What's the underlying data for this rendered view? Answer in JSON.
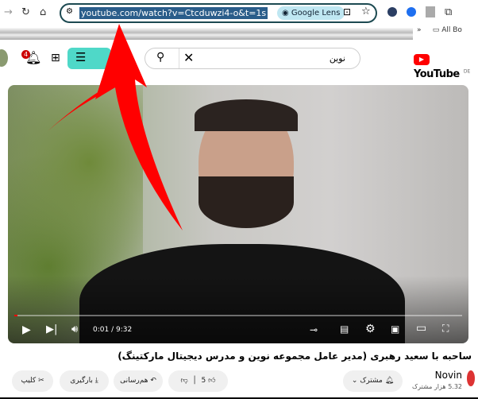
{
  "browser": {
    "url": "youtube.com/watch?v=Ctcduwzi4-o&t=1s",
    "lens_label": "Google Lens",
    "bookmarks_label": "All Bo"
  },
  "youtube": {
    "logo": "YouTube",
    "region": "DE",
    "notification_count": "4",
    "search_value": "نوین"
  },
  "player": {
    "time": "0:01 / 9:32",
    "progress": 0.002
  },
  "video": {
    "title": "ساحبه با سعید رهبری (مدیر عامل مجموعه نوین و مدرس دیجیتال مارکتینگ)",
    "channel": "Novin",
    "subscribers": "5.32 هزار مشترک",
    "subscribe_label": "مشترک",
    "likes": "5",
    "share_label": "هم‌رسانی",
    "download_label": "بارگیری",
    "clip_label": "کلیپ"
  },
  "colors": {
    "accent_red": "#ff0000",
    "url_border": "#1d4a52",
    "highlight": "#2a5d8a",
    "menu_button": "#4fd8c8"
  }
}
